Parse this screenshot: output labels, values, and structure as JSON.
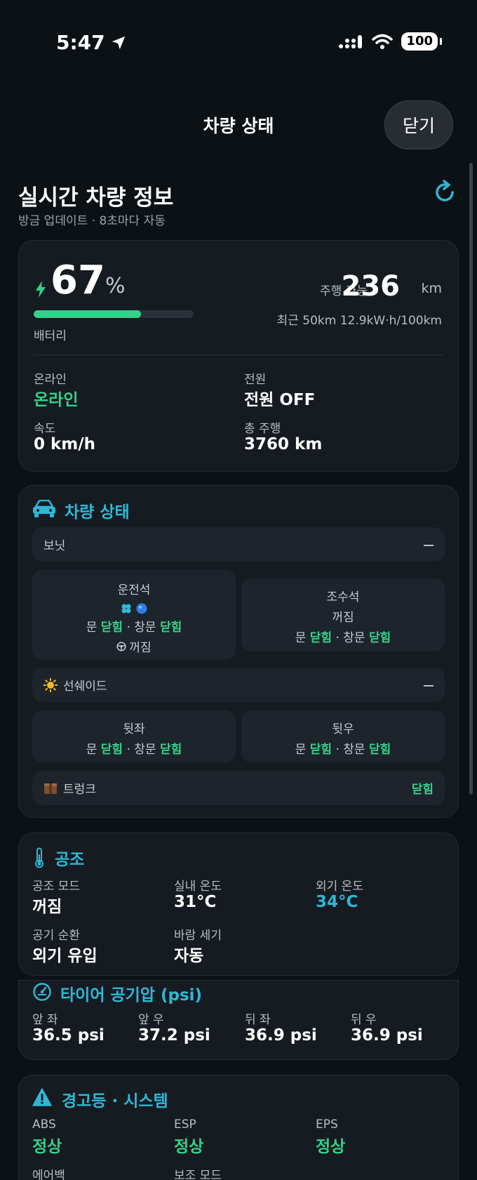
{
  "status_bar": {
    "time": "5:47",
    "battery": "100"
  },
  "header": {
    "title": "차량 상태",
    "close_label": "닫기"
  },
  "overview": {
    "title": "실시간 차량 정보",
    "subtitle": "방금 업데이트 · 8초마다 자동"
  },
  "battery": {
    "percent": "67",
    "percent_unit": "%",
    "level": 0.67,
    "caption": "배터리",
    "range_label": "주행 가능",
    "range_value": "236",
    "range_unit": "km",
    "efficiency": "최근 50km 12.9kW·h/100km"
  },
  "summary": {
    "online_label": "온라인",
    "online_value": "온라인",
    "power_label": "전원",
    "power_value": "전원 OFF",
    "speed_label": "속도",
    "speed_value": "0 km/h",
    "odometer_label": "총 주행",
    "odometer_value": "3760 km"
  },
  "vehicle": {
    "title": "차량 상태",
    "bonnet": "보닛",
    "driver": {
      "label": "운전석",
      "door": "문",
      "door_state": "닫힘",
      "window": "· 창문",
      "window_state": "닫힘",
      "wheel_state": "꺼짐"
    },
    "passenger": {
      "label": "조수석",
      "seat_state": "꺼짐",
      "door": "문",
      "door_state": "닫힘",
      "window": "· 창문",
      "window_state": "닫힘"
    },
    "sunshade": "선쉐이드",
    "rear_left": {
      "label": "뒷좌",
      "door": "문",
      "door_state": "닫힘",
      "window": "· 창문",
      "window_state": "닫힘"
    },
    "rear_right": {
      "label": "뒷우",
      "door": "문",
      "door_state": "닫힘",
      "window": "· 창문",
      "window_state": "닫힘"
    },
    "trunk": "트렁크",
    "trunk_state": "닫힘"
  },
  "climate": {
    "title": "공조",
    "mode_label": "공조 모드",
    "mode_value": "꺼짐",
    "inside_label": "실내 온도",
    "inside_value": "31°C",
    "outside_label": "외기 온도",
    "outside_value": "34°C",
    "circ_label": "공기 순환",
    "circ_value": "외기 유입",
    "fan_label": "바람 세기",
    "fan_value": "자동"
  },
  "tires": {
    "title": "타이어 공기압 (psi)",
    "items": [
      {
        "label": "앞 좌",
        "value": "36.5 psi"
      },
      {
        "label": "앞 우",
        "value": "37.2 psi"
      },
      {
        "label": "뒤 좌",
        "value": "36.9 psi"
      },
      {
        "label": "뒤 우",
        "value": "36.9 psi"
      }
    ]
  },
  "warnings": {
    "title": "경고등 · 시스템",
    "items": [
      {
        "label": "ABS",
        "value": "정상"
      },
      {
        "label": "ESP",
        "value": "정상"
      },
      {
        "label": "EPS",
        "value": "정상"
      },
      {
        "label": "에어백",
        "value": ""
      },
      {
        "label": "보조 모드",
        "value": ""
      }
    ]
  }
}
